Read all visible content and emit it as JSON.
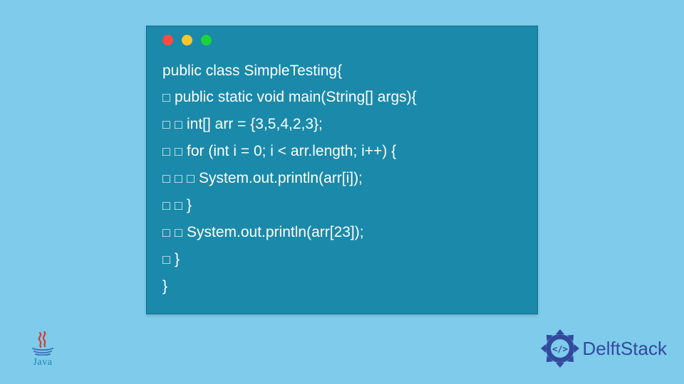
{
  "code": {
    "lines": [
      {
        "indent": 0,
        "text": "public class SimpleTesting{"
      },
      {
        "indent": 1,
        "text": "public static void main(String[] args){"
      },
      {
        "indent": 2,
        "text": "int[] arr = {3,5,4,2,3};"
      },
      {
        "indent": 2,
        "text": "for (int i = 0; i < arr.length; i++) {"
      },
      {
        "indent": 3,
        "text": "System.out.println(arr[i]);"
      },
      {
        "indent": 2,
        "text": "}"
      },
      {
        "indent": 2,
        "text": "System.out.println(arr[23]);"
      },
      {
        "indent": 1,
        "text": "}"
      },
      {
        "indent": 0,
        "text": "}"
      }
    ]
  },
  "java_logo": {
    "label": "Java"
  },
  "delft_logo": {
    "label": "DelftStack"
  },
  "colors": {
    "page_bg": "#7ecbeb",
    "window_bg": "#1b89a9",
    "code_fg": "#ffffff",
    "logo_accent": "#324a9e",
    "java_red": "#d83a2e"
  }
}
